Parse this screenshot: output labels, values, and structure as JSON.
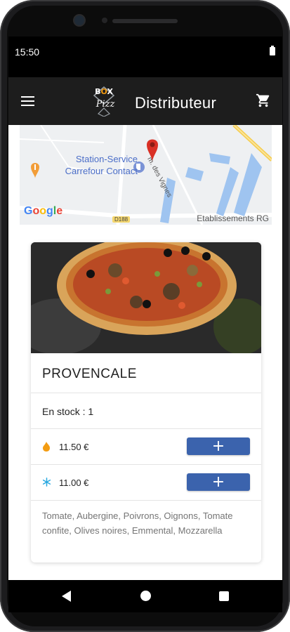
{
  "status_bar": {
    "time": "15:50"
  },
  "app_bar": {
    "title": "Distributeur",
    "logo_text_top": "B",
    "logo_text_box_o": "X",
    "logo_text_bottom": "izz"
  },
  "map": {
    "poi_name": "Station-Service Carrefour Contact",
    "road_name": "m. des Vignes",
    "road_code": "D188",
    "attribution": "Etablissements RG",
    "provider": "Google"
  },
  "product": {
    "name": "PROVENCALE",
    "stock_label": "En stock : 1",
    "prices": [
      {
        "icon": "flame-icon",
        "icon_color": "#f39c12",
        "value": "11.50  €",
        "button_label": "+"
      },
      {
        "icon": "snowflake-icon",
        "icon_color": "#29a8e0",
        "value": "11.00  €",
        "button_label": "+"
      }
    ],
    "ingredients": "Tomate, Aubergine, Poivrons, Oignons, Tomate confite, Olives noires, Emmental, Mozzarella"
  },
  "colors": {
    "app_bar": "#1d1d1d",
    "button": "#3b63ad",
    "map_pin": "#d93025",
    "poi_text": "#4b6ec8"
  }
}
